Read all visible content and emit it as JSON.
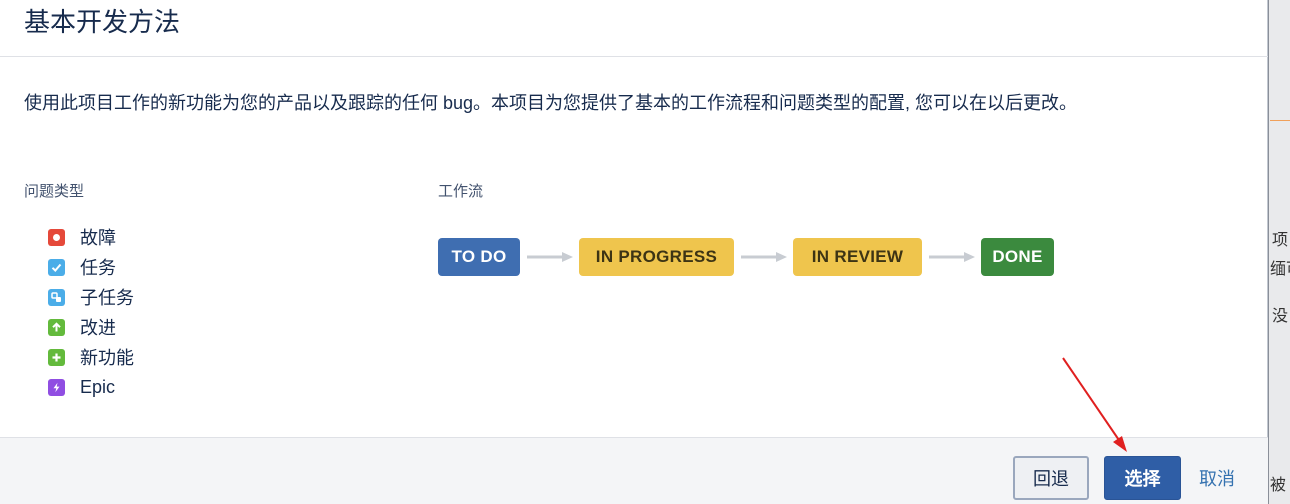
{
  "dialog": {
    "title": "基本开发方法",
    "description": "使用此项目工作的新功能为您的产品以及跟踪的任何 bug。本项目为您提供了基本的工作流程和问题类型的配置, 您可以在以后更改。"
  },
  "issue_types": {
    "heading": "问题类型",
    "items": [
      {
        "label": "故障",
        "icon": "bug-icon",
        "color": "#e5493a"
      },
      {
        "label": "任务",
        "icon": "task-check-icon",
        "color": "#4bade8"
      },
      {
        "label": "子任务",
        "icon": "subtask-icon",
        "color": "#4bade8"
      },
      {
        "label": "改进",
        "icon": "improvement-arrow-up-icon",
        "color": "#63ba3c"
      },
      {
        "label": "新功能",
        "icon": "new-feature-plus-icon",
        "color": "#63ba3c"
      },
      {
        "label": "Epic",
        "icon": "epic-lightning-icon",
        "color": "#904ee2"
      }
    ]
  },
  "workflow": {
    "heading": "工作流",
    "statuses": [
      {
        "label": "TO DO",
        "color": "#3f6eb1"
      },
      {
        "label": "IN PROGRESS",
        "color": "#efc54d"
      },
      {
        "label": "IN REVIEW",
        "color": "#efc54d"
      },
      {
        "label": "DONE",
        "color": "#3b8a3e"
      }
    ]
  },
  "footer": {
    "back_label": "回退",
    "select_label": "选择",
    "cancel_label": "取消"
  },
  "background_page": {
    "fragments": [
      "项",
      "缅可",
      "没",
      "被"
    ]
  },
  "annotation": {
    "color": "#e02020"
  }
}
